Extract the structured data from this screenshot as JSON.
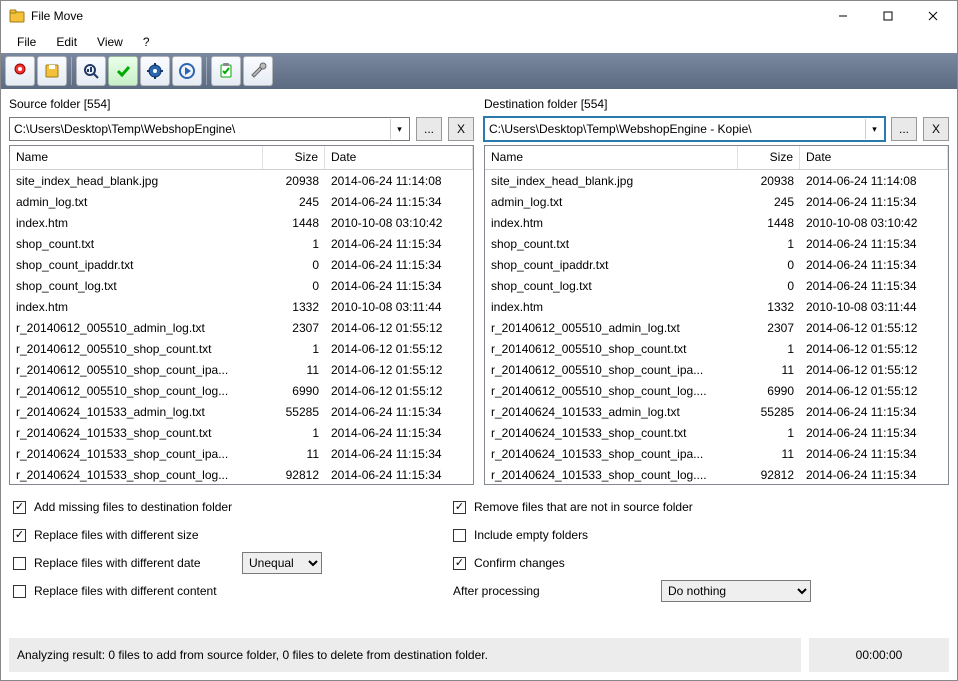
{
  "window": {
    "title": "File Move"
  },
  "menu": {
    "file": "File",
    "edit": "Edit",
    "view": "View",
    "help": "?"
  },
  "source": {
    "label": "Source folder [554]",
    "path": "C:\\Users\\Desktop\\Temp\\WebshopEngine\\",
    "browse": "...",
    "clear": "X",
    "columns": {
      "name": "Name",
      "size": "Size",
      "date": "Date"
    },
    "rows": [
      {
        "name": "site_index_head_blank.jpg",
        "size": "20938",
        "date": "2014-06-24 11:14:08"
      },
      {
        "name": "admin_log.txt",
        "size": "245",
        "date": "2014-06-24 11:15:34"
      },
      {
        "name": "index.htm",
        "size": "1448",
        "date": "2010-10-08 03:10:42"
      },
      {
        "name": "shop_count.txt",
        "size": "1",
        "date": "2014-06-24 11:15:34"
      },
      {
        "name": "shop_count_ipaddr.txt",
        "size": "0",
        "date": "2014-06-24 11:15:34"
      },
      {
        "name": "shop_count_log.txt",
        "size": "0",
        "date": "2014-06-24 11:15:34"
      },
      {
        "name": "index.htm",
        "size": "1332",
        "date": "2010-10-08 03:11:44"
      },
      {
        "name": "r_20140612_005510_admin_log.txt",
        "size": "2307",
        "date": "2014-06-12 01:55:12"
      },
      {
        "name": "r_20140612_005510_shop_count.txt",
        "size": "1",
        "date": "2014-06-12 01:55:12"
      },
      {
        "name": "r_20140612_005510_shop_count_ipa...",
        "size": "11",
        "date": "2014-06-12 01:55:12"
      },
      {
        "name": "r_20140612_005510_shop_count_log...",
        "size": "6990",
        "date": "2014-06-12 01:55:12"
      },
      {
        "name": "r_20140624_101533_admin_log.txt",
        "size": "55285",
        "date": "2014-06-24 11:15:34"
      },
      {
        "name": "r_20140624_101533_shop_count.txt",
        "size": "1",
        "date": "2014-06-24 11:15:34"
      },
      {
        "name": "r_20140624_101533_shop_count_ipa...",
        "size": "11",
        "date": "2014-06-24 11:15:34"
      },
      {
        "name": "r_20140624_101533_shop_count_log...",
        "size": "92812",
        "date": "2014-06-24 11:15:34"
      }
    ]
  },
  "dest": {
    "label": "Destination folder [554]",
    "path": "C:\\Users\\Desktop\\Temp\\WebshopEngine - Kopie\\",
    "browse": "...",
    "clear": "X",
    "columns": {
      "name": "Name",
      "size": "Size",
      "date": "Date"
    },
    "rows": [
      {
        "name": "site_index_head_blank.jpg",
        "size": "20938",
        "date": "2014-06-24 11:14:08"
      },
      {
        "name": "admin_log.txt",
        "size": "245",
        "date": "2014-06-24 11:15:34"
      },
      {
        "name": "index.htm",
        "size": "1448",
        "date": "2010-10-08 03:10:42"
      },
      {
        "name": "shop_count.txt",
        "size": "1",
        "date": "2014-06-24 11:15:34"
      },
      {
        "name": "shop_count_ipaddr.txt",
        "size": "0",
        "date": "2014-06-24 11:15:34"
      },
      {
        "name": "shop_count_log.txt",
        "size": "0",
        "date": "2014-06-24 11:15:34"
      },
      {
        "name": "index.htm",
        "size": "1332",
        "date": "2010-10-08 03:11:44"
      },
      {
        "name": "r_20140612_005510_admin_log.txt",
        "size": "2307",
        "date": "2014-06-12 01:55:12"
      },
      {
        "name": "r_20140612_005510_shop_count.txt",
        "size": "1",
        "date": "2014-06-12 01:55:12"
      },
      {
        "name": "r_20140612_005510_shop_count_ipa...",
        "size": "11",
        "date": "2014-06-12 01:55:12"
      },
      {
        "name": "r_20140612_005510_shop_count_log....",
        "size": "6990",
        "date": "2014-06-12 01:55:12"
      },
      {
        "name": "r_20140624_101533_admin_log.txt",
        "size": "55285",
        "date": "2014-06-24 11:15:34"
      },
      {
        "name": "r_20140624_101533_shop_count.txt",
        "size": "1",
        "date": "2014-06-24 11:15:34"
      },
      {
        "name": "r_20140624_101533_shop_count_ipa...",
        "size": "11",
        "date": "2014-06-24 11:15:34"
      },
      {
        "name": "r_20140624_101533_shop_count_log....",
        "size": "92812",
        "date": "2014-06-24 11:15:34"
      }
    ]
  },
  "options": {
    "add_missing": "Add missing files to destination folder",
    "replace_size": "Replace files with different size",
    "replace_date": "Replace files with different date",
    "replace_content": "Replace files with different content",
    "remove_notin": "Remove files that are not in source folder",
    "include_empty": "Include empty folders",
    "confirm": "Confirm changes",
    "after_label": "After processing",
    "date_mode": "Unequal",
    "after_value": "Do nothing"
  },
  "status": {
    "text": "Analyzing result: 0 files to add from source folder, 0 files to delete from destination folder.",
    "time": "00:00:00"
  }
}
